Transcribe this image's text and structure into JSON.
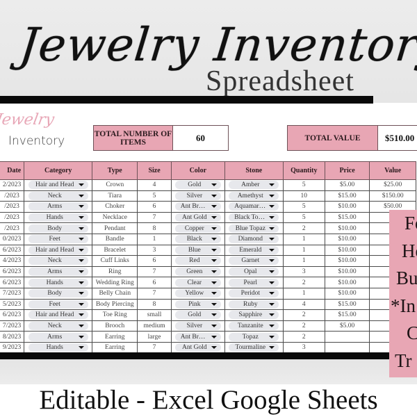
{
  "header": {
    "title": "Jewelry Inventory",
    "subtitle": "Spreadsheet"
  },
  "logo": {
    "script": "Jewelry",
    "word": "Inventory"
  },
  "summary": {
    "total_items_label": "TOTAL NUMBER OF ITEMS",
    "total_items_value": "60",
    "total_value_label": "TOTAL VALUE",
    "total_value_value": "$510.00"
  },
  "table": {
    "columns": [
      "Date",
      "Category",
      "Type",
      "Size",
      "Color",
      "Stone",
      "Quantity",
      "Price",
      "Value"
    ],
    "rows": [
      {
        "date": "2/2023",
        "category": "Hair and Head",
        "type": "Crown",
        "size": "4",
        "color": "Gold",
        "stone": "Amber",
        "quantity": "5",
        "price": "$5.00",
        "value": "$25.00"
      },
      {
        "date": "/2023",
        "category": "Neck",
        "type": "Tiara",
        "size": "5",
        "color": "Silver",
        "stone": "Amethyst",
        "quantity": "10",
        "price": "$15.00",
        "value": "$150.00"
      },
      {
        "date": "/2023",
        "category": "Arms",
        "type": "Choker",
        "size": "6",
        "color": "Ant Bronze",
        "stone": "Aquamarine",
        "quantity": "5",
        "price": "$10.00",
        "value": "$50.00"
      },
      {
        "date": "/2023",
        "category": "Hands",
        "type": "Necklace",
        "size": "7",
        "color": "Ant Gold",
        "stone": "Black Tou…",
        "quantity": "5",
        "price": "$15.00",
        "value": ""
      },
      {
        "date": "/2023",
        "category": "Body",
        "type": "Pendant",
        "size": "8",
        "color": "Copper",
        "stone": "Blue Topaz",
        "quantity": "2",
        "price": "$10.00",
        "value": ""
      },
      {
        "date": "0/2023",
        "category": "Feet",
        "type": "Bandle",
        "size": "1",
        "color": "Black",
        "stone": "Diamond",
        "quantity": "1",
        "price": "$10.00",
        "value": ""
      },
      {
        "date": "6/2023",
        "category": "Hair and Head",
        "type": "Bracelet",
        "size": "3",
        "color": "Blue",
        "stone": "Emerald",
        "quantity": "1",
        "price": "$10.00",
        "value": ""
      },
      {
        "date": "4/2023",
        "category": "Neck",
        "type": "Cuff Links",
        "size": "6",
        "color": "Red",
        "stone": "Garnet",
        "quantity": "1",
        "price": "$10.00",
        "value": ""
      },
      {
        "date": "6/2023",
        "category": "Arms",
        "type": "Ring",
        "size": "7",
        "color": "Green",
        "stone": "Opal",
        "quantity": "3",
        "price": "$10.00",
        "value": ""
      },
      {
        "date": "6/2023",
        "category": "Hands",
        "type": "Wedding Ring",
        "size": "6",
        "color": "Clear",
        "stone": "Pearl",
        "quantity": "2",
        "price": "$10.00",
        "value": ""
      },
      {
        "date": "7/2023",
        "category": "Body",
        "type": "Belly Chain",
        "size": "7",
        "color": "Yellow",
        "stone": "Peridot",
        "quantity": "1",
        "price": "$10.00",
        "value": ""
      },
      {
        "date": "5/2023",
        "category": "Feet",
        "type": "Body Piercing",
        "size": "8",
        "color": "Pink",
        "stone": "Ruby",
        "quantity": "4",
        "price": "$15.00",
        "value": ""
      },
      {
        "date": "6/2023",
        "category": "Hair and Head",
        "type": "Toe Ring",
        "size": "small",
        "color": "Gold",
        "stone": "Sapphire",
        "quantity": "2",
        "price": "$15.00",
        "value": ""
      },
      {
        "date": "7/2023",
        "category": "Neck",
        "type": "Brooch",
        "size": "medium",
        "color": "Silver",
        "stone": "Tanzanite",
        "quantity": "2",
        "price": "$5.00",
        "value": ""
      },
      {
        "date": "8/2023",
        "category": "Arms",
        "type": "Earring",
        "size": "large",
        "color": "Ant Bronze",
        "stone": "Topaz",
        "quantity": "2",
        "price": "",
        "value": ""
      },
      {
        "date": "9/2023",
        "category": "Hands",
        "type": "Earring",
        "size": "7",
        "color": "Ant Gold",
        "stone": "Tourmaline",
        "quantity": "3",
        "price": "",
        "value": ""
      }
    ]
  },
  "promo": {
    "lines": [
      "Fo",
      "Ho",
      "Bu",
      "*In",
      "C",
      "Tr"
    ]
  },
  "footer": {
    "text": "Editable - Excel Google Sheets"
  },
  "colors": {
    "accent_pink": "#e8a6b4",
    "logo_pink": "#e8a7b7",
    "bar_black": "#0a0a0a",
    "dropdown_bg": "#e7e8ec"
  }
}
